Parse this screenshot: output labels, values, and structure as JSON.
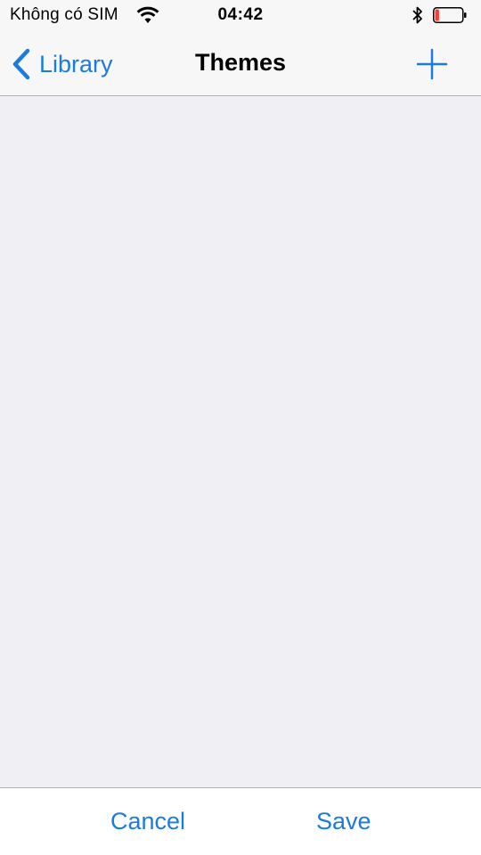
{
  "status_bar": {
    "carrier": "Không có SIM",
    "time": "04:42",
    "icons": [
      "wifi-icon",
      "bluetooth-icon",
      "battery-icon"
    ],
    "battery_level": 0.15,
    "battery_color": "#ff3b30"
  },
  "nav": {
    "back_label": "Library",
    "title": "Themes",
    "add_icon": "plus-icon"
  },
  "toolbar": {
    "cancel_label": "Cancel",
    "save_label": "Save"
  },
  "colors": {
    "accent": "#1a7be0",
    "background": "#efeff4"
  }
}
